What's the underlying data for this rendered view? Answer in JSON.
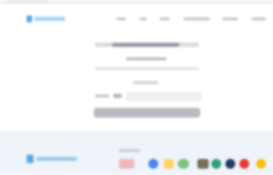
{
  "header": {
    "nav_links": [
      "",
      "",
      "",
      "",
      "",
      ""
    ]
  },
  "form": {
    "submit_label": ""
  },
  "footer": {
    "partner_badges": [
      {
        "icon": "badge-1-icon",
        "color": "#f1b6bf"
      },
      {
        "icon": "badge-2-icon",
        "color": "#4a86e8"
      },
      {
        "icon": "badge-3-icon",
        "color": "#ffd166"
      },
      {
        "icon": "badge-4-icon",
        "color": "#7bc47f"
      },
      {
        "icon": "badge-5-icon",
        "color": "#7b6f55"
      },
      {
        "icon": "badge-6-icon",
        "color": "#2f9e7a"
      },
      {
        "icon": "badge-7-icon",
        "color": "#243a5e"
      },
      {
        "icon": "badge-8-icon",
        "color": "#e53935"
      },
      {
        "icon": "badge-9-icon",
        "color": "#f1c40f"
      }
    ]
  },
  "colors": {
    "brand": "#5aa9e6",
    "footer_bg": "#eef4f9",
    "button": "#b9b9bf"
  }
}
